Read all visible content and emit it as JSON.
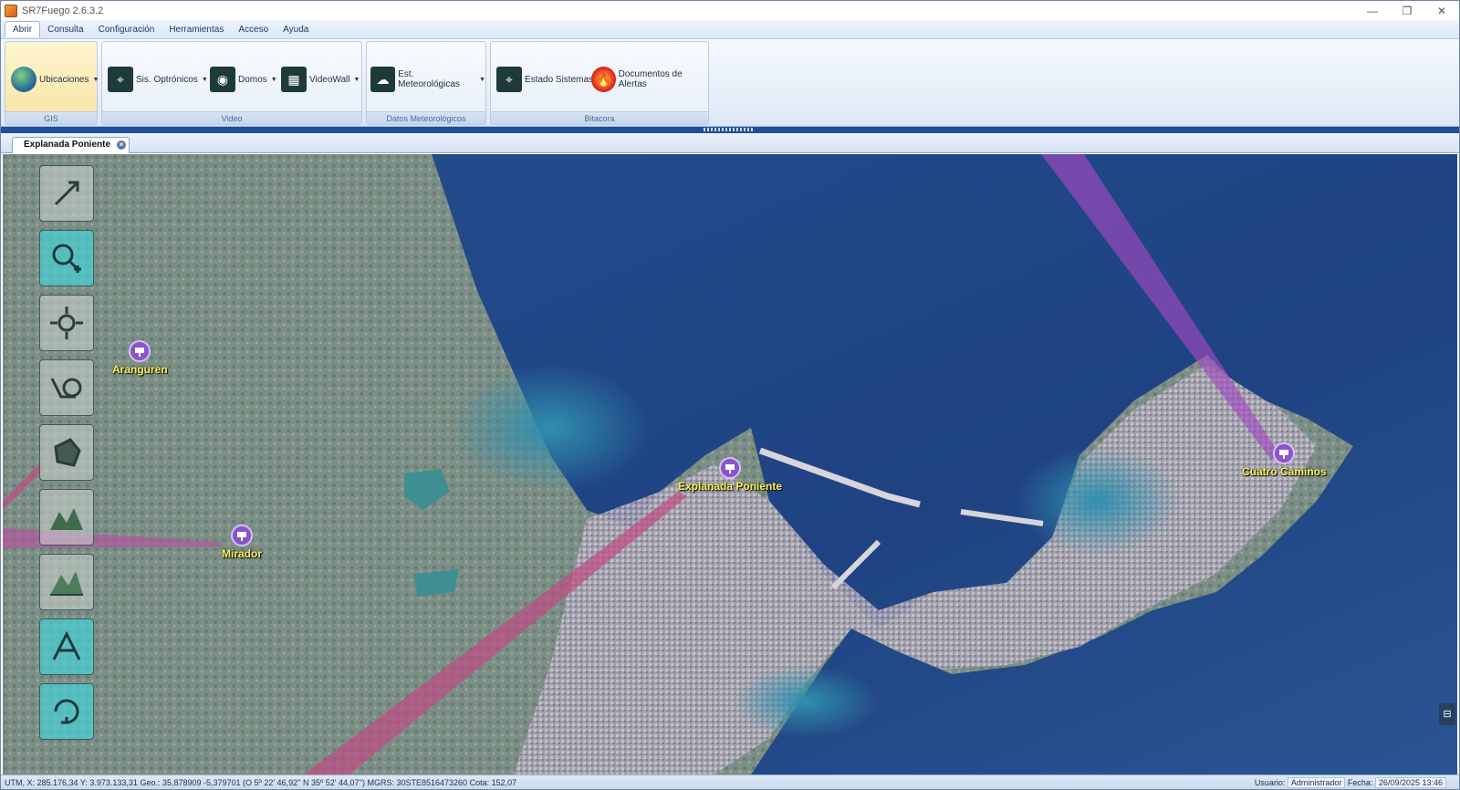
{
  "window": {
    "title": "SR7Fuego 2.6.3.2",
    "controls": [
      "—",
      "❐",
      "✕"
    ]
  },
  "menu": [
    "Abrir",
    "Consulta",
    "Configuración",
    "Herramientas",
    "Acceso",
    "Ayuda"
  ],
  "ribbon": {
    "groups": [
      {
        "label": "GIS",
        "buttons": [
          {
            "label": "Ubicaciones",
            "icon": "globe-icon",
            "dropdown": true
          }
        ]
      },
      {
        "label": "Video",
        "buttons": [
          {
            "label": "Sis. Optrónicos",
            "icon": "optronic-camera-icon",
            "dropdown": true
          },
          {
            "label": "Domos",
            "icon": "dome-camera-icon",
            "dropdown": true
          },
          {
            "label": "VideoWall",
            "icon": "videowall-icon",
            "dropdown": true
          }
        ]
      },
      {
        "label": "Datos Meteorológicos",
        "buttons": [
          {
            "label": "Est. Meteorológicas",
            "icon": "weather-station-icon",
            "dropdown": true
          }
        ]
      },
      {
        "label": "Bitacora",
        "buttons": [
          {
            "label": "Estado Sistemas",
            "icon": "system-status-icon",
            "dropdown": false
          },
          {
            "label": "Documentos de Alertas",
            "icon": "alert-documents-icon",
            "dropdown": false
          }
        ]
      }
    ]
  },
  "document_tab": {
    "label": "Explanada Poniente"
  },
  "map": {
    "tools": [
      "select-arrow-icon",
      "zoom-in-icon",
      "pan-icon",
      "camera-view-icon",
      "polygon-icon",
      "terrain-icon",
      "terrain-3d-icon",
      "measure-icon",
      "rotate-icon"
    ],
    "stations": [
      "Aranguren",
      "Mirador",
      "Explanada Poniente",
      "Cuatro Caminos"
    ]
  },
  "statusbar": {
    "coords": "UTM, X: 285.176,34  Y: 3.973.133,31   Geo.: 35,878909 -5,379701 (O 5º 22' 46,92'' N 35º 52' 44,07'')   MGRS: 30STE8516473260 Cota: 152,07",
    "user_label": "Usuario:",
    "user_value": "Administrador",
    "date_label": "Fecha:",
    "date_value": "26/09/2025 13:46"
  }
}
